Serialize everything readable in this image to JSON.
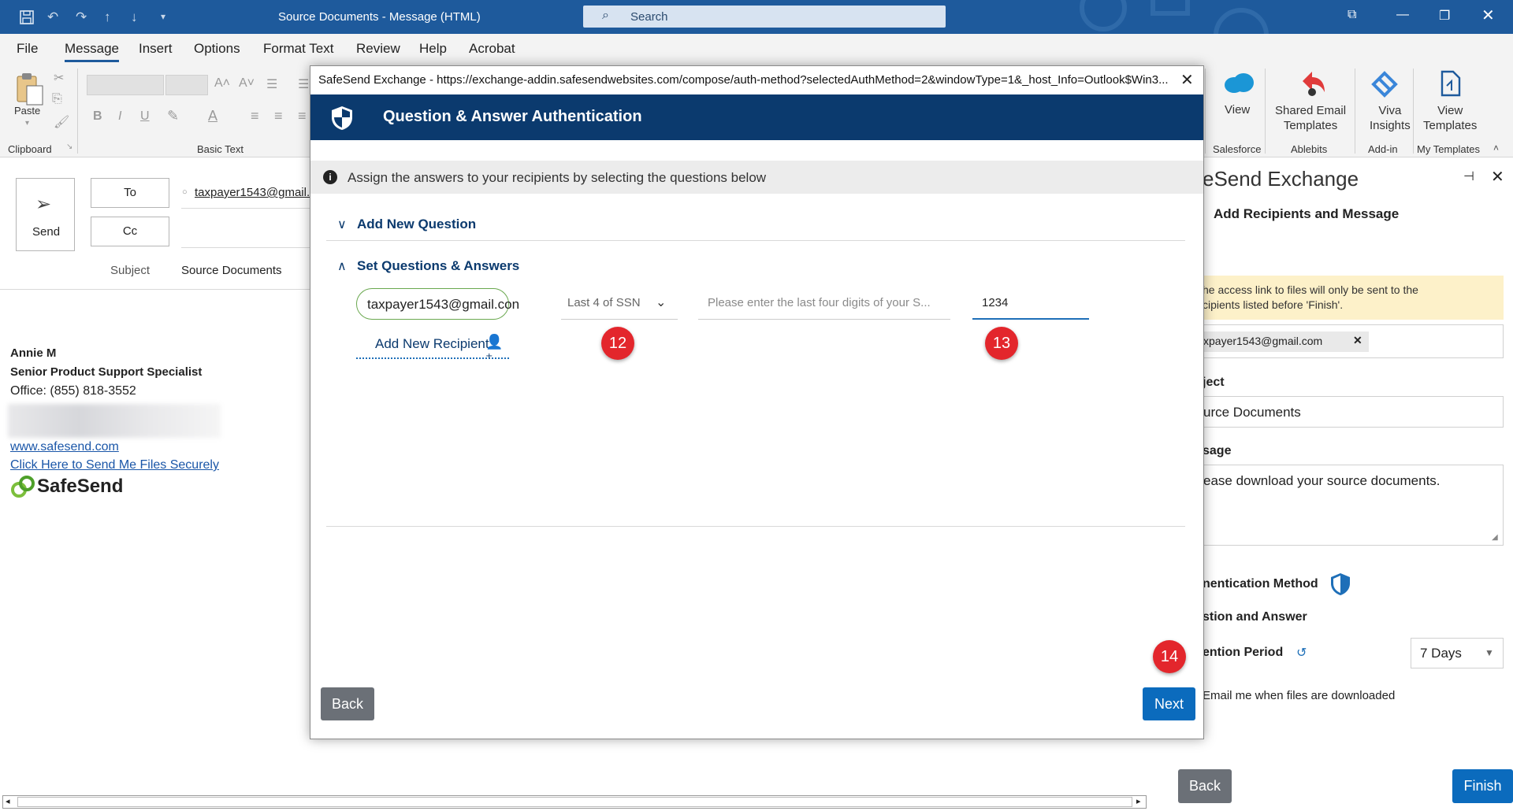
{
  "window": {
    "title": "Source Documents  -  Message (HTML)",
    "search_placeholder": "Search"
  },
  "menu": [
    "File",
    "Message",
    "Insert",
    "Options",
    "Format Text",
    "Review",
    "Help",
    "Acrobat"
  ],
  "ribbon": {
    "paste_label": "Paste",
    "clipboard_group": "Clipboard",
    "basic_text_group": "Basic Text",
    "view_label": "View",
    "salesforce_group": "Salesforce",
    "shared_email_templates_label": "Shared Email\nTemplates",
    "ablebits_group": "Ablebits",
    "viva_insights_label": "Viva\nInsights",
    "addin_group": "Add-in",
    "view_templates_label": "View\nTemplates",
    "my_templates_group": "My Templates"
  },
  "compose": {
    "send_label": "Send",
    "to_label": "To",
    "cc_label": "Cc",
    "to_value": "taxpayer1543@gmail.c",
    "subject_label": "Subject",
    "subject_value": "Source Documents",
    "signature": {
      "name": "Annie M",
      "title": "Senior Product Support Specialist",
      "office": "Office: (855) 818-3552",
      "website": "www.safesend.com",
      "secure_link": "Click Here to Send Me Files Securely",
      "logo_text": "SafeSend"
    }
  },
  "dialog": {
    "url_title": "SafeSend Exchange - https://exchange-addin.safesendwebsites.com/compose/auth-method?selectedAuthMethod=2&windowType=1&_host_Info=Outlook$Win3...",
    "header": "Question & Answer Authentication",
    "info": "Assign the answers to your recipients by selecting the questions below",
    "add_new_question": "Add New Question",
    "set_questions": "Set Questions & Answers",
    "recipient": "taxpayer1543@gmail.con",
    "question_select": "Last 4 of SSN",
    "question_placeholder": "Please enter the last four digits of your S...",
    "answer": "1234",
    "add_new_recipient": "Add New Recipient",
    "back": "Back",
    "next": "Next",
    "step_badges": [
      "12",
      "13",
      "14"
    ]
  },
  "pane": {
    "title": "eSend Exchange",
    "subtitle": "Add Recipients and Message",
    "notice": "he access link to files will only be sent to the\ncipients listed before 'Finish'.",
    "recipient_chip": "xpayer1543@gmail.com",
    "subject_label": "ject",
    "subject_value": "urce Documents",
    "message_label": "sage",
    "message_value": "ease download your source documents.",
    "auth_method_label": "nentication Method",
    "auth_value": "stion and Answer",
    "retention_label": "ention Period",
    "retention_value": "7 Days",
    "email_me": "Email me when files are downloaded",
    "back": "Back",
    "finish": "Finish"
  }
}
